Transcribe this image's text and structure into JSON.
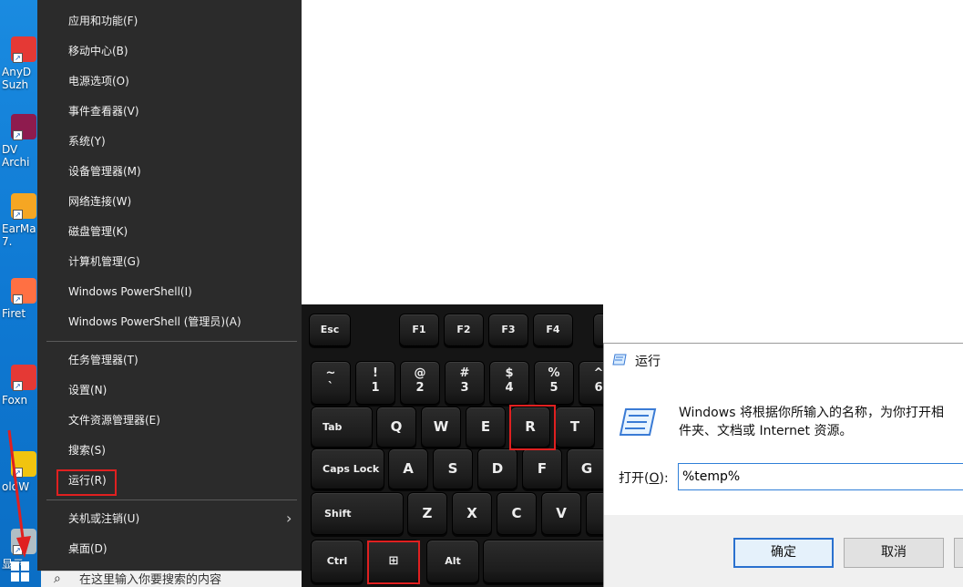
{
  "desktop": {
    "icons": [
      {
        "label": "AnyD\nSuzh",
        "icon": "anydesk-icon",
        "color": "#e53935"
      },
      {
        "label": "DV\nArchi",
        "icon": "dvd-icon",
        "color": "#8e1b4e"
      },
      {
        "label": "EarMa\n7.",
        "icon": "earmaster-icon",
        "color": "#f5a623"
      },
      {
        "label": "Firet",
        "icon": "firetools-icon",
        "color": "#ff7043"
      },
      {
        "label": "Foxn",
        "icon": "foxit-icon",
        "color": "#e53935"
      },
      {
        "label": "oldW",
        "icon": "goldwave-icon",
        "color": "#f1c40f"
      },
      {
        "label": "显示",
        "icon": "display-icon",
        "color": "#b0bec5"
      }
    ]
  },
  "winx_menu": {
    "group1": [
      "应用和功能(F)",
      "移动中心(B)",
      "电源选项(O)",
      "事件查看器(V)",
      "系统(Y)",
      "设备管理器(M)",
      "网络连接(W)",
      "磁盘管理(K)",
      "计算机管理(G)",
      "Windows PowerShell(I)",
      "Windows PowerShell (管理员)(A)"
    ],
    "group2": [
      "任务管理器(T)",
      "设置(N)",
      "文件资源管理器(E)",
      "搜索(S)",
      "运行(R)"
    ],
    "group3": [
      "关机或注销(U)",
      "桌面(D)"
    ],
    "highlighted_item": "运行(R)",
    "submenu_chevron": "›"
  },
  "taskbar": {
    "search_placeholder": "在这里输入你要搜索的内容",
    "search_icon": "search-icon",
    "start_icon": "windows-logo-icon"
  },
  "keyboard": {
    "fn_row": [
      "Esc",
      "F1",
      "F2",
      "F3",
      "F4"
    ],
    "number_row": [
      {
        "top": "~",
        "bottom": "`"
      },
      {
        "top": "!",
        "bottom": "1"
      },
      {
        "top": "@",
        "bottom": "2"
      },
      {
        "top": "#",
        "bottom": "3"
      },
      {
        "top": "$",
        "bottom": "4"
      },
      {
        "top": "%",
        "bottom": "5"
      },
      {
        "top": "^",
        "bottom": "6"
      }
    ],
    "tab_row": [
      "Tab",
      "Q",
      "W",
      "E",
      "R",
      "T"
    ],
    "caps_row": [
      "Caps Lock",
      "A",
      "S",
      "D",
      "F",
      "G"
    ],
    "shift_row": [
      "Shift",
      "Z",
      "X",
      "C",
      "V"
    ],
    "bottom_row": [
      "Ctrl",
      "win",
      "Alt"
    ],
    "highlighted_keys": [
      "R",
      "win"
    ],
    "highlight_color": "#e02020"
  },
  "run_dialog": {
    "title": "运行",
    "description": "Windows 将根据你所输入的名称，为你打开相\n件夹、文档或 Internet 资源。",
    "open_label_prefix": "打开(",
    "open_label_key": "O",
    "open_label_suffix": "):",
    "input_value": "%temp%",
    "ok_label": "确定",
    "cancel_label": "取消",
    "accent": "#2a71cf"
  }
}
